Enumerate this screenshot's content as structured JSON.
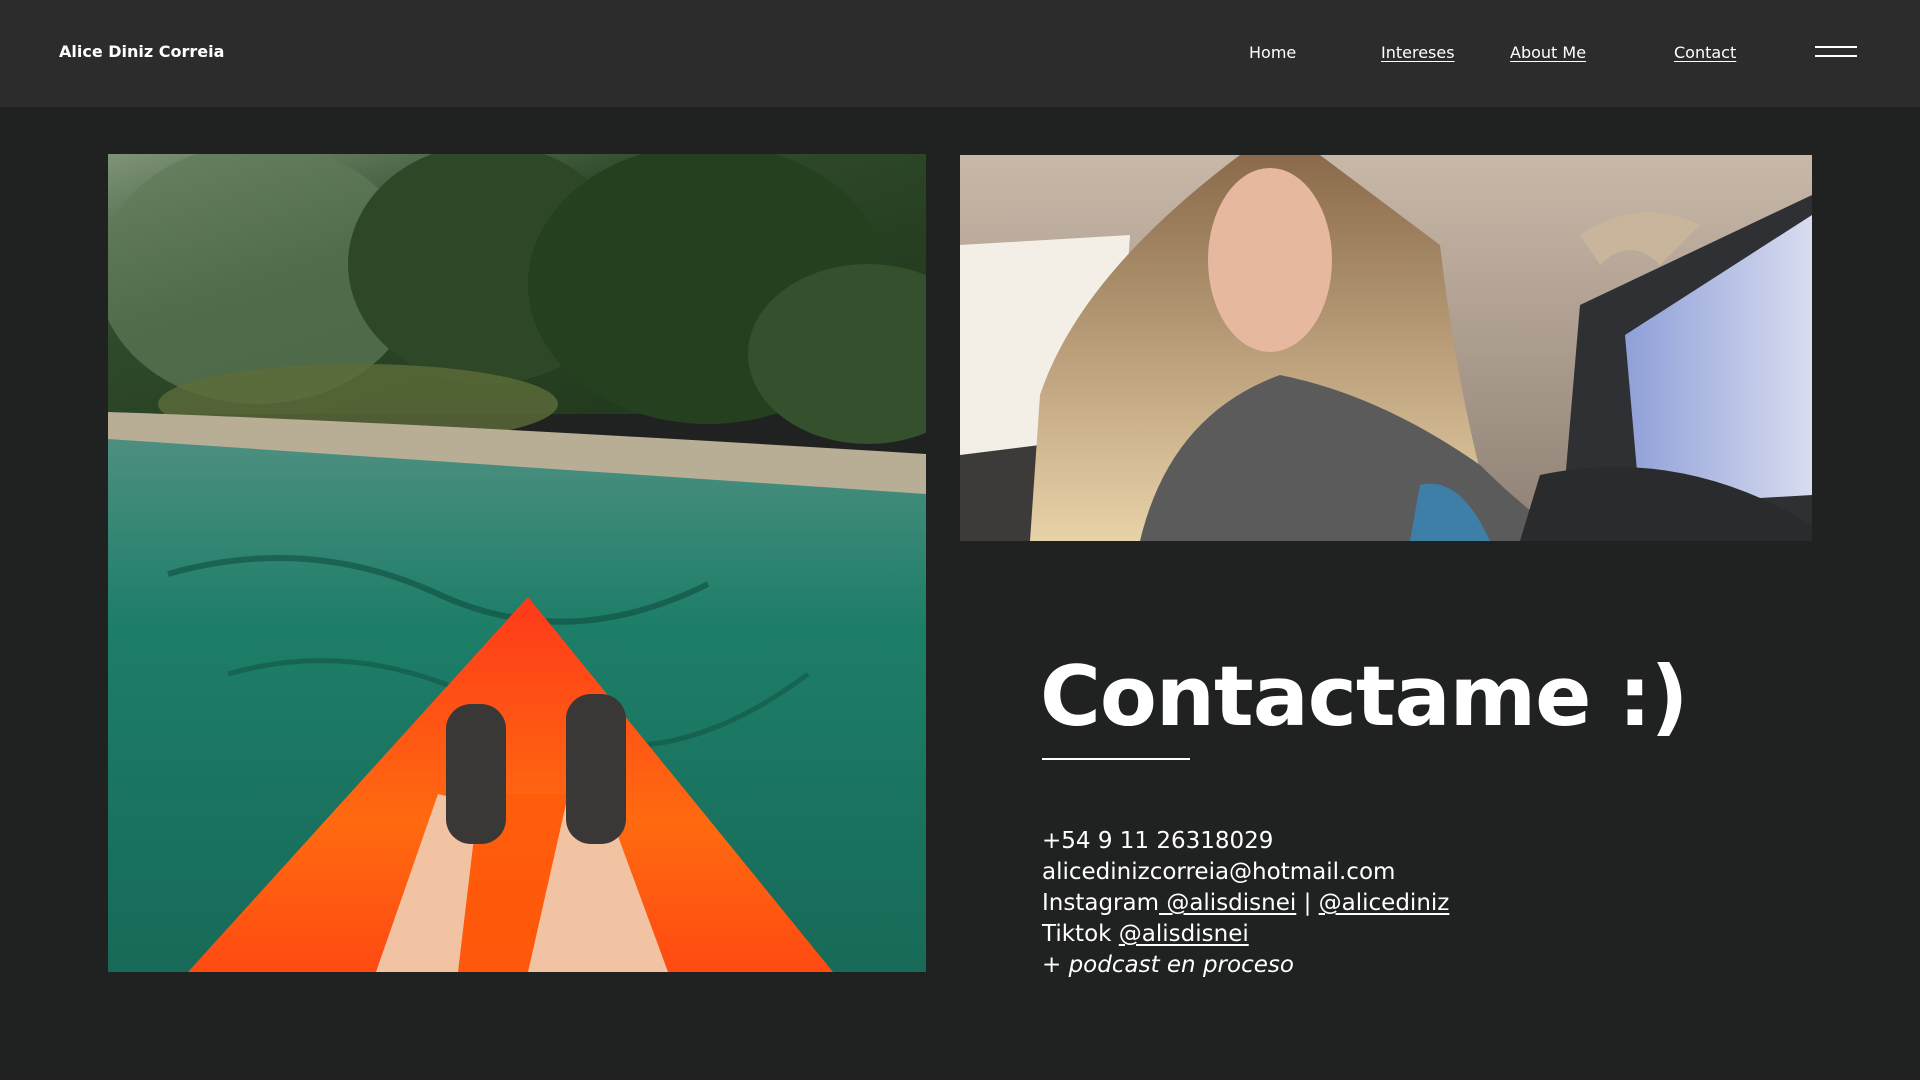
{
  "header": {
    "brand": "Alice Diniz Correia",
    "nav": [
      {
        "label": "Home"
      },
      {
        "label": "Intereses"
      },
      {
        "label": "About Me"
      },
      {
        "label": "Contact"
      }
    ],
    "menu_icon": "hamburger-menu-icon"
  },
  "main": {
    "title": "Contactame :)",
    "phone": "+54 9 11 26318029",
    "email": "alicedinizcorreia@hotmail.com",
    "instagram_label": "Instagram",
    "instagram_handle_1": " @alisdisnei",
    "instagram_separator": " | ",
    "instagram_handle_2": "@alicediniz",
    "tiktok_label": "Tiktok ",
    "tiktok_handle": "@alisdisnei",
    "podcast_note": "+ podcast en proceso"
  },
  "colors": {
    "background": "#202221",
    "header": "#2c2c2c",
    "text": "#ffffff"
  }
}
